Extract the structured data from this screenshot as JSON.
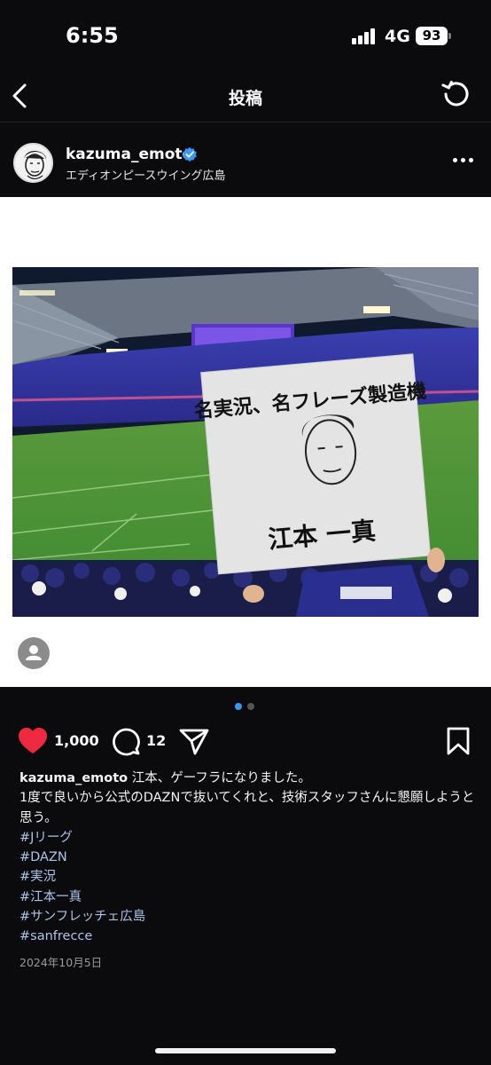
{
  "status_bar": {
    "time": "6:55",
    "network": "4G",
    "battery": "93"
  },
  "nav": {
    "title": "投稿",
    "back_icon": "chevron-left-icon",
    "refresh_icon": "refresh-icon"
  },
  "post": {
    "username": "kazuma_emoto",
    "verified": true,
    "location": "エディオンピースウイング広島",
    "banner_text": {
      "top": "名実況、名フレーズ製造機",
      "bottom": "江本 一真"
    },
    "likes": "1,000",
    "comments": "12",
    "caption": {
      "line1": "江本、ゲーフラになりました。",
      "line2": "1度で良いから公式のDAZNで抜いてくれと、技術スタッフさんに懇願しようと思う。"
    },
    "tags": [
      "#Jリーグ",
      "#DAZN",
      "#実況",
      "#江本一真",
      "#サンフレッチェ広島",
      "#sanfrecce"
    ],
    "date": "2024年10月5日",
    "carousel": {
      "count": 2,
      "active": 0
    }
  },
  "colors": {
    "background": "#0b0b0d",
    "like_red": "#ed2a3f",
    "verified_blue": "#3897f0",
    "hashtag": "#aac4ea",
    "dot_active": "#3897f0"
  }
}
